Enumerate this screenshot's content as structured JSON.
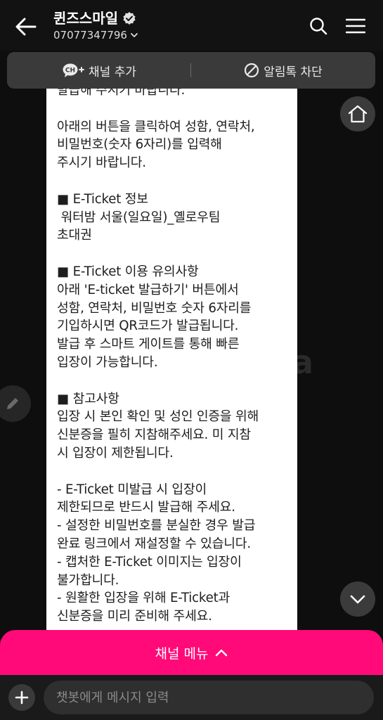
{
  "header": {
    "title": "퀸즈스마일",
    "phone": "07077347796"
  },
  "channel_bar": {
    "add_label": "채널 추가",
    "block_label": "알림톡 차단",
    "ch_badge": "CH"
  },
  "message": {
    "lines": [
      "발급해 주시기 바랍니다.",
      "",
      "아래의 버튼을 클릭하여 성함, 연락처,",
      "비밀번호(숫자 6자리)를 입력해",
      "주시기 바랍니다.",
      "",
      "■ E-Ticket 정보",
      " 워터밤 서울(일요일)_옐로우팀",
      "초대권",
      "",
      "■ E-Ticket 이용 유의사항",
      "아래 'E-ticket 발급하기' 버튼에서",
      "성함, 연락처, 비밀번호 숫자 6자리를",
      "기입하시면 QR코드가 발급됩니다.",
      "발급 후 스마트 게이트를 통해 빠른",
      "입장이 가능합니다.",
      "",
      "■ 참고사항",
      "입장 시 본인 확인 및 성인 인증을 위해",
      "신분증을 필히 지참해주세요. 미 지참",
      "시 입장이 제한됩니다.",
      "",
      "- E-Ticket 미발급 시 입장이",
      "제한되므로 반드시 발급해 주세요.",
      "- 설정한 비밀번호를 분실한 경우 발급",
      "완료 링크에서 재설정할 수 있습니다.",
      "- 캡처한 E-Ticket 이미지는 입장이",
      "불가합니다.",
      "- 원활한 입장을 위해 E-Ticket과",
      "신분증을 미리 준비해 주세요."
    ],
    "watermark": "a"
  },
  "channel_menu": {
    "label": "채널 메뉴"
  },
  "input": {
    "placeholder": "챗봇에게 메시지 입력"
  },
  "colors": {
    "accent": "#ff0a78",
    "background": "#0e0e0e",
    "bar": "#3a3a3a"
  },
  "icons": {
    "back": "arrow-left-icon",
    "verified": "verified-badge-icon",
    "search": "search-icon",
    "menu": "hamburger-menu-icon",
    "home": "home-icon",
    "edit": "pencil-icon",
    "scroll_down": "chevron-down-icon",
    "plus": "plus-icon",
    "block": "block-icon"
  }
}
